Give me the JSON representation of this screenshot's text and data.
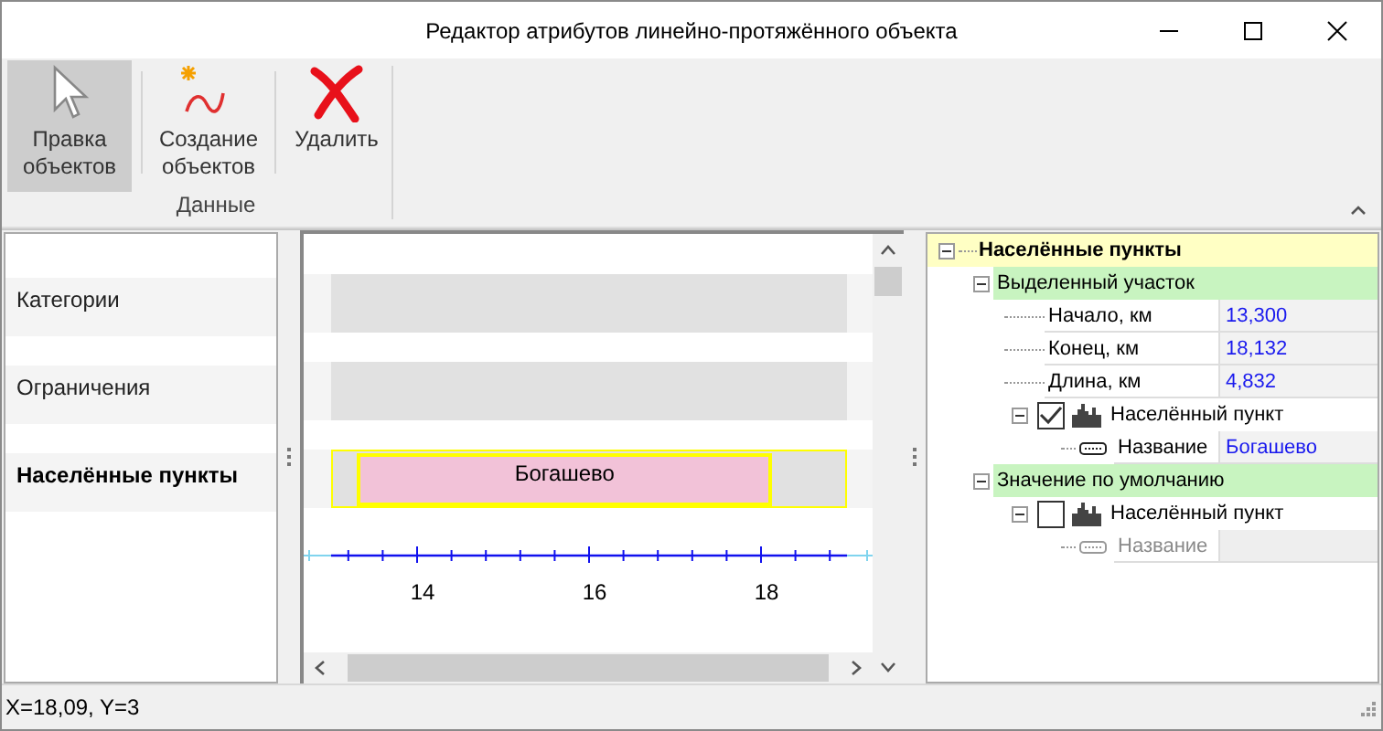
{
  "window": {
    "title": "Редактор атрибутов линейно-протяжённого объекта"
  },
  "ribbon": {
    "buttons": [
      {
        "kind": "edit",
        "label": "Правка объектов",
        "selected": true
      },
      {
        "kind": "create",
        "label": "Создание объектов",
        "selected": false
      },
      {
        "kind": "delete",
        "label": "Удалить",
        "selected": false
      }
    ],
    "group_label": "Данные"
  },
  "layers": [
    {
      "label": "Категории",
      "selected": false
    },
    {
      "label": "Ограничения",
      "selected": false
    },
    {
      "label": "Населённые пункты",
      "selected": true,
      "segments": [
        {
          "label": "Богашево"
        }
      ]
    }
  ],
  "axis": {
    "ticks": [
      "14",
      "16",
      "18"
    ]
  },
  "tree": {
    "title": "Населённые пункты",
    "expanded": true,
    "children": [
      {
        "kind": "group",
        "label": "Выделенный участок",
        "expanded": true,
        "children": [
          {
            "kind": "property",
            "label": "Начало, км",
            "value": "13,300"
          },
          {
            "kind": "property",
            "label": "Конец, км",
            "value": "18,132"
          },
          {
            "kind": "property",
            "label": "Длина, км",
            "value": "4,832"
          },
          {
            "kind": "object",
            "label": "Населённый пункт",
            "checked": true,
            "expanded": true,
            "children": [
              {
                "kind": "field",
                "label": "Название",
                "value": "Богашево",
                "disabled": false
              }
            ]
          }
        ]
      },
      {
        "kind": "group",
        "label": "Значение по умолчанию",
        "expanded": true,
        "children": [
          {
            "kind": "object",
            "label": "Населённый пункт",
            "checked": false,
            "expanded": true,
            "children": [
              {
                "kind": "field",
                "label": "Название",
                "disabled": true
              }
            ]
          }
        ]
      }
    ]
  },
  "status_bar": {
    "text": "X=18,09, Y=3"
  }
}
